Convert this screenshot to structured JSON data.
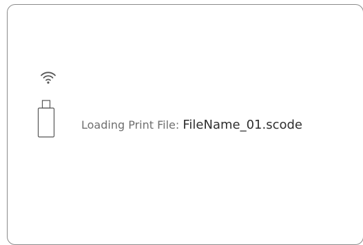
{
  "status": {
    "label": "Loading Print File: ",
    "filename": "FileName_01.scode"
  },
  "icons": {
    "connection": "wifi-icon",
    "storage": "usb-drive-icon"
  },
  "colors": {
    "border": "#8a8a8a",
    "icon": "#555555",
    "label_text": "#6f6f6f",
    "filename_text": "#2e2e2e",
    "background": "#ffffff"
  }
}
